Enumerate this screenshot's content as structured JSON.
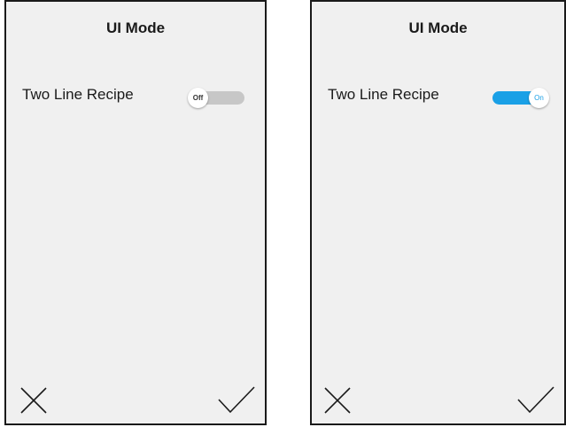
{
  "screens": [
    {
      "title": "UI Mode",
      "setting": {
        "label": "Two Line Recipe",
        "toggle_text": "Off",
        "state": "off"
      },
      "actions": {
        "cancel_icon": "close-icon",
        "confirm_icon": "checkmark-icon"
      }
    },
    {
      "title": "UI Mode",
      "setting": {
        "label": "Two Line Recipe",
        "toggle_text": "On",
        "state": "on"
      },
      "actions": {
        "cancel_icon": "close-icon",
        "confirm_icon": "checkmark-icon"
      }
    }
  ],
  "colors": {
    "panel_background": "#f0f0f0",
    "toggle_on": "#1aa0e6",
    "toggle_off": "#c7c7c7",
    "border": "#1a1a1a"
  }
}
